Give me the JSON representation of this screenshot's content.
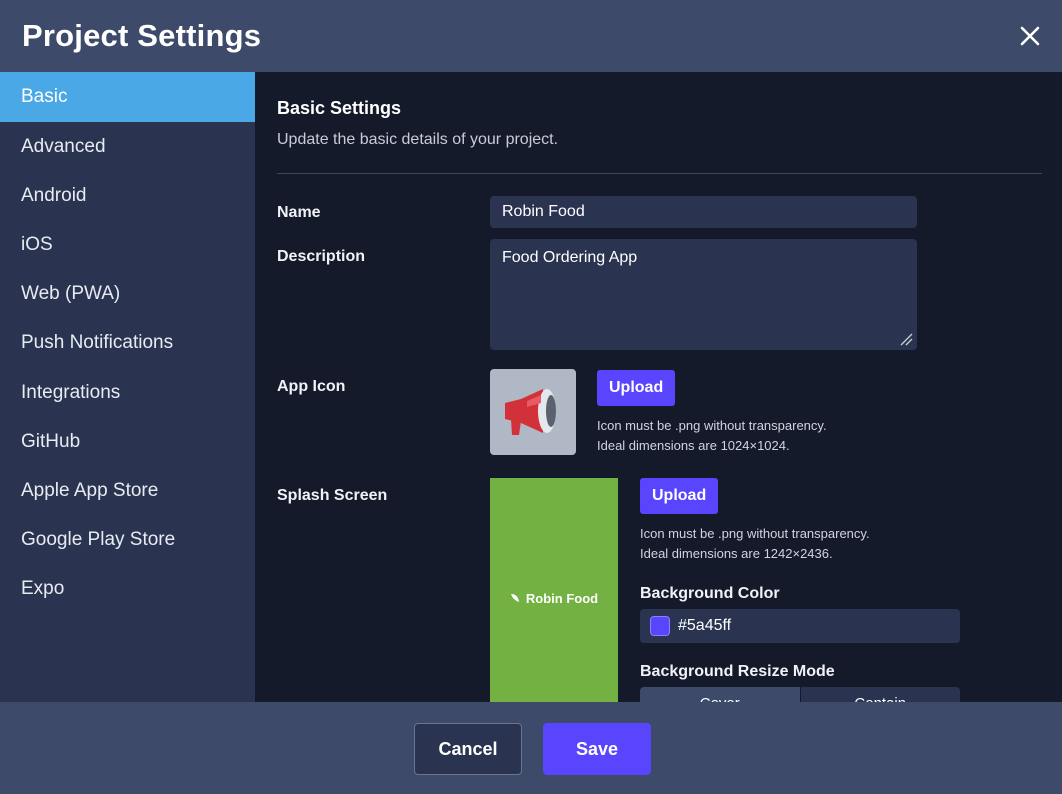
{
  "header": {
    "title": "Project Settings",
    "close_icon": "close-icon"
  },
  "sidebar": {
    "items": [
      {
        "label": "Basic",
        "active": true
      },
      {
        "label": "Advanced"
      },
      {
        "label": "Android"
      },
      {
        "label": "iOS"
      },
      {
        "label": "Web (PWA)"
      },
      {
        "label": "Push Notifications"
      },
      {
        "label": "Integrations"
      },
      {
        "label": "GitHub"
      },
      {
        "label": "Apple App Store"
      },
      {
        "label": "Google Play Store"
      },
      {
        "label": "Expo"
      }
    ]
  },
  "main": {
    "title": "Basic Settings",
    "subtitle": "Update the basic details of your project.",
    "name": {
      "label": "Name",
      "value": "Robin Food"
    },
    "description": {
      "label": "Description",
      "value": "Food Ordering App"
    },
    "app_icon": {
      "label": "App Icon",
      "upload_label": "Upload",
      "hint_line1": "Icon must be .png without transparency.",
      "hint_line2": "Ideal dimensions are 1024×1024.",
      "preview_icon": "megaphone-icon"
    },
    "splash": {
      "label": "Splash Screen",
      "upload_label": "Upload",
      "hint_line1": "Icon must be .png without transparency.",
      "hint_line2": "Ideal dimensions are 1242×2436.",
      "brand_text": "Robin Food",
      "preview_bg": "#72b142",
      "bg_color_label": "Background Color",
      "bg_color_value": "#5a45ff",
      "resize_label": "Background Resize Mode",
      "resize_options": [
        "Cover",
        "Contain"
      ],
      "resize_selected": "Cover"
    }
  },
  "footer": {
    "cancel_label": "Cancel",
    "save_label": "Save"
  },
  "colors": {
    "accent": "#5a45ff",
    "active_nav": "#4aa8e6",
    "header": "#3d4a6a",
    "panel": "#2a3450",
    "background": "#151a2b"
  }
}
